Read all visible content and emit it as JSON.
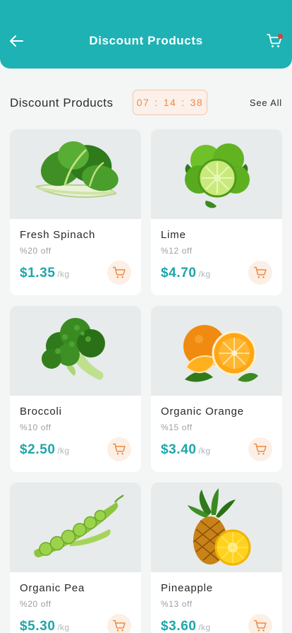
{
  "header": {
    "title": "Discount Products",
    "background": "#1eb2b4"
  },
  "section": {
    "title": "Discount Products",
    "timer": {
      "hours": "07",
      "minutes": "14",
      "seconds": "38",
      "separator": ":"
    },
    "see_all": "See All"
  },
  "colors": {
    "accent": "#1eb2b4",
    "price": "#1ea6a8",
    "timer": "#f0883e",
    "cart_button_bg": "#fcefe6",
    "cart_badge": "#e53935"
  },
  "products": [
    {
      "name": "Fresh Spinach",
      "discount": "%20 off",
      "price": "$1.35",
      "unit": "/kg",
      "image_icon": "spinach-icon"
    },
    {
      "name": "Lime",
      "discount": "%12 off",
      "price": "$4.70",
      "unit": "/kg",
      "image_icon": "lime-icon"
    },
    {
      "name": "Broccoli",
      "discount": "%10 off",
      "price": "$2.50",
      "unit": "/kg",
      "image_icon": "broccoli-icon"
    },
    {
      "name": "Organic Orange",
      "discount": "%15 off",
      "price": "$3.40",
      "unit": "/kg",
      "image_icon": "orange-icon"
    },
    {
      "name": "Organic Pea",
      "discount": "%20 off",
      "price": "$5.30",
      "unit": "/kg",
      "image_icon": "pea-icon"
    },
    {
      "name": "Pineapple",
      "discount": "%13 off",
      "price": "$3.60",
      "unit": "/kg",
      "image_icon": "pineapple-icon"
    }
  ]
}
